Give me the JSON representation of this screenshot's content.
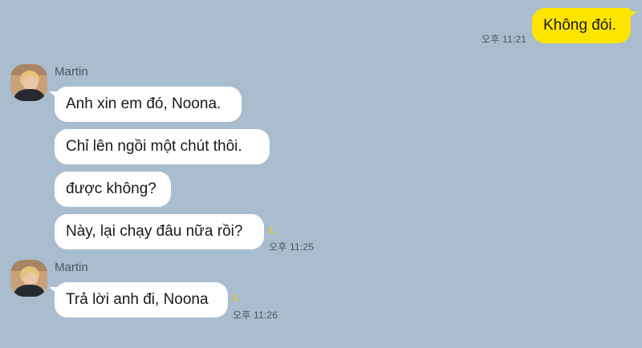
{
  "outgoing": {
    "text": "Không đói.",
    "time": "오후 11:21"
  },
  "groups": [
    {
      "sender": "Martin",
      "messages": [
        "Anh xin em đó, Noona.",
        "Chỉ lên ngồi một chút thôi.",
        "được không?",
        "Này, lại chạy đâu nữa rồi?"
      ],
      "unread": "1",
      "time": "오후 11:25"
    },
    {
      "sender": "Martin",
      "messages": [
        "Trả lời anh đi, Noona"
      ],
      "unread": "1",
      "time": "오후 11:26"
    }
  ],
  "colors": {
    "background": "#a9bdcf",
    "outgoing_bubble": "#fee500",
    "incoming_bubble": "#ffffff",
    "unread_count": "#f3d100"
  }
}
